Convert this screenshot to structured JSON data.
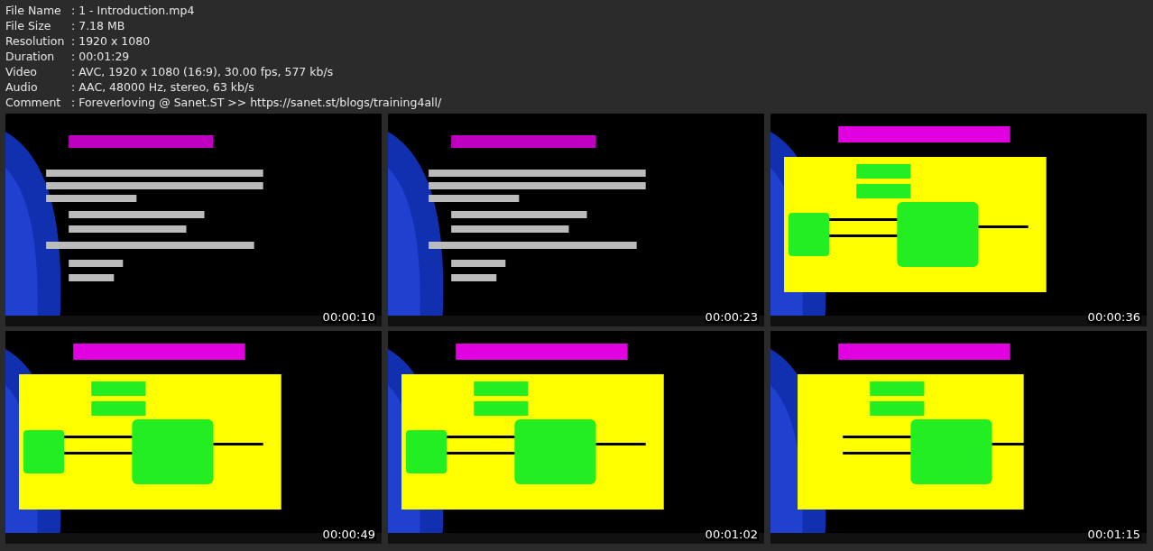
{
  "info": [
    {
      "label": "File Name",
      "value": ": 1 - Introduction.mp4"
    },
    {
      "label": "File Size",
      "value": ": 7.18 MB"
    },
    {
      "label": "Resolution",
      "value": ": 1920 x 1080"
    },
    {
      "label": "Duration",
      "value": ": 00:01:29"
    },
    {
      "label": "Video",
      "value": ": AVC, 1920 x 1080 (16:9), 30.00 fps, 577 kb/s"
    },
    {
      "label": "Audio",
      "value": ": AAC, 48000 Hz, stereo, 63 kb/s"
    },
    {
      "label": "Comment",
      "value": ": Foreverloving @ Sanet.ST >> https://sanet.st/blogs/training4all/"
    }
  ],
  "thumbnails": [
    {
      "kind": "picture",
      "timestamp": "00:00:10"
    },
    {
      "kind": "picture",
      "timestamp": "00:00:23"
    },
    {
      "kind": "picture",
      "timestamp": "00:00:36"
    },
    {
      "kind": "picture",
      "timestamp": "00:00:49"
    },
    {
      "kind": "picture",
      "timestamp": "00:01:02"
    },
    {
      "kind": "picture",
      "timestamp": "00:01:15"
    }
  ]
}
